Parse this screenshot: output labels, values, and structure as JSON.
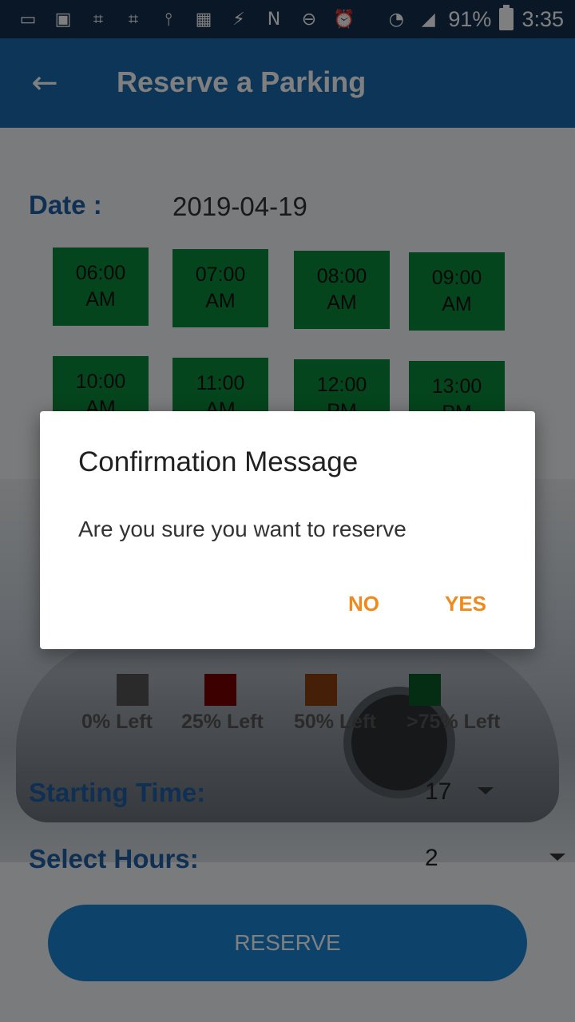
{
  "status_bar": {
    "battery": "91%",
    "time": "3:35",
    "icons": [
      "chat-icon",
      "image-icon",
      "code-icon",
      "code-icon",
      "usb-icon",
      "media-icon",
      "flash-icon",
      "nfc-icon",
      "dnd-icon",
      "alarm-icon",
      "wifi-icon",
      "signal-icon",
      "battery-icon"
    ]
  },
  "appbar": {
    "title": "Reserve a Parking",
    "back_icon": "arrow-left-icon"
  },
  "date": {
    "label": "Date :",
    "value": "2019-04-19"
  },
  "slots": [
    {
      "time": "06:00",
      "period": "AM"
    },
    {
      "time": "07:00",
      "period": "AM"
    },
    {
      "time": "08:00",
      "period": "AM"
    },
    {
      "time": "09:00",
      "period": "AM"
    },
    {
      "time": "10:00",
      "period": "AM"
    },
    {
      "time": "11:00",
      "period": "AM"
    },
    {
      "time": "12:00",
      "period": "PM"
    },
    {
      "time": "13:00",
      "period": "PM"
    }
  ],
  "legend": [
    {
      "label": "0% Left",
      "color": "#555555"
    },
    {
      "label": "25% Left",
      "color": "#7a0000"
    },
    {
      "label": "50% Left",
      "color": "#8b3f0f"
    },
    {
      "label": ">75% Left",
      "color": "#0a5a28"
    }
  ],
  "starting_time": {
    "label": "Starting Time:",
    "value": "17"
  },
  "select_hours": {
    "label": "Select Hours:",
    "value": "2"
  },
  "reserve_button": "RESERVE",
  "dialog": {
    "title": "Confirmation Message",
    "message": "Are you sure you want to reserve",
    "no": "NO",
    "yes": "YES"
  },
  "colors": {
    "appbar": "#1b6bb0",
    "slot_green": "#0a8a3a",
    "accent_orange": "#ef8a1f",
    "label_blue": "#1e5fa6"
  }
}
